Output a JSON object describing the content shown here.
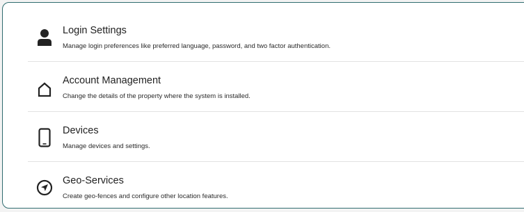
{
  "settings": {
    "items": [
      {
        "title": "Login Settings",
        "description": "Manage login preferences like preferred language, password, and two factor authentication.",
        "icon": "user-icon"
      },
      {
        "title": "Account Management",
        "description": "Change the details of the property where the system is installed.",
        "icon": "home-icon"
      },
      {
        "title": "Devices",
        "description": "Manage devices and settings.",
        "icon": "phone-icon"
      },
      {
        "title": "Geo-Services",
        "description": "Create geo-fences and configure other location features.",
        "icon": "navigation-icon"
      }
    ]
  },
  "colors": {
    "border": "#2f6b6f",
    "icon": "#222222",
    "divider": "#e2e2e2"
  }
}
